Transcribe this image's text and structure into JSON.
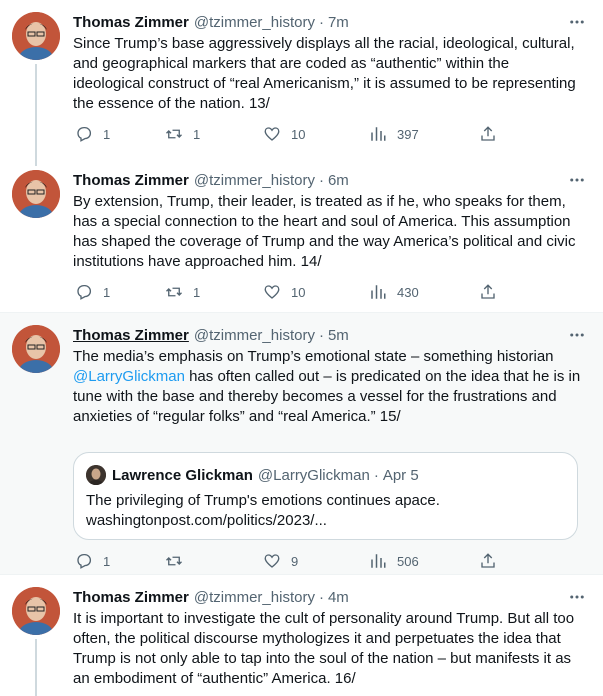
{
  "colors": {
    "accent": "#1d9bf0",
    "secondary_text": "#536471",
    "hover_bg": "#f7f9f9"
  },
  "tweets": [
    {
      "name": "Thomas Zimmer",
      "handle": "@tzimmer_history",
      "time": "7m",
      "text": "Since Trump’s base aggressively displays all the racial, ideological, cultural, and geographical markers that are coded as “authentic” within the ideological construct of “real Americanism,” it is assumed to be representing the essence of the nation. 13/",
      "replies": "1",
      "retweets": "1",
      "likes": "10",
      "views": "397"
    },
    {
      "name": "Thomas Zimmer",
      "handle": "@tzimmer_history",
      "time": "6m",
      "text": "By extension, Trump, their leader, is treated as if he, who speaks for them, has a special connection to the heart and soul of America. This assumption has shaped the coverage of Trump and the way America’s political and civic institutions have approached him. 14/",
      "replies": "1",
      "retweets": "1",
      "likes": "10",
      "views": "430"
    },
    {
      "name": "Thomas Zimmer",
      "handle": "@tzimmer_history",
      "time": "5m",
      "text_before": "The media’s emphasis on Trump’s emotional state – something historian ",
      "mention": "@LarryGlickman",
      "text_after": " has often called out – is predicated on the idea that he is in tune with the base and thereby becomes a vessel for the frustrations and anxieties of “regular folks” and “real America.” 15/",
      "replies": "1",
      "retweets": "",
      "likes": "9",
      "views": "506",
      "quote": {
        "name": "Lawrence Glickman",
        "handle": "@LarryGlickman",
        "date": "Apr 5",
        "line1": "The privileging of Trump's emotions continues apace.",
        "line2": "washingtonpost.com/politics/2023/..."
      }
    },
    {
      "name": "Thomas Zimmer",
      "handle": "@tzimmer_history",
      "time": "4m",
      "text": "It is important to investigate the cult of personality around Trump. But all too often, the political discourse mythologizes it and perpetuates the idea that Trump is not only able to tap into the soul of the nation – but manifests it as an embodiment of “authentic” America. 16/"
    }
  ]
}
